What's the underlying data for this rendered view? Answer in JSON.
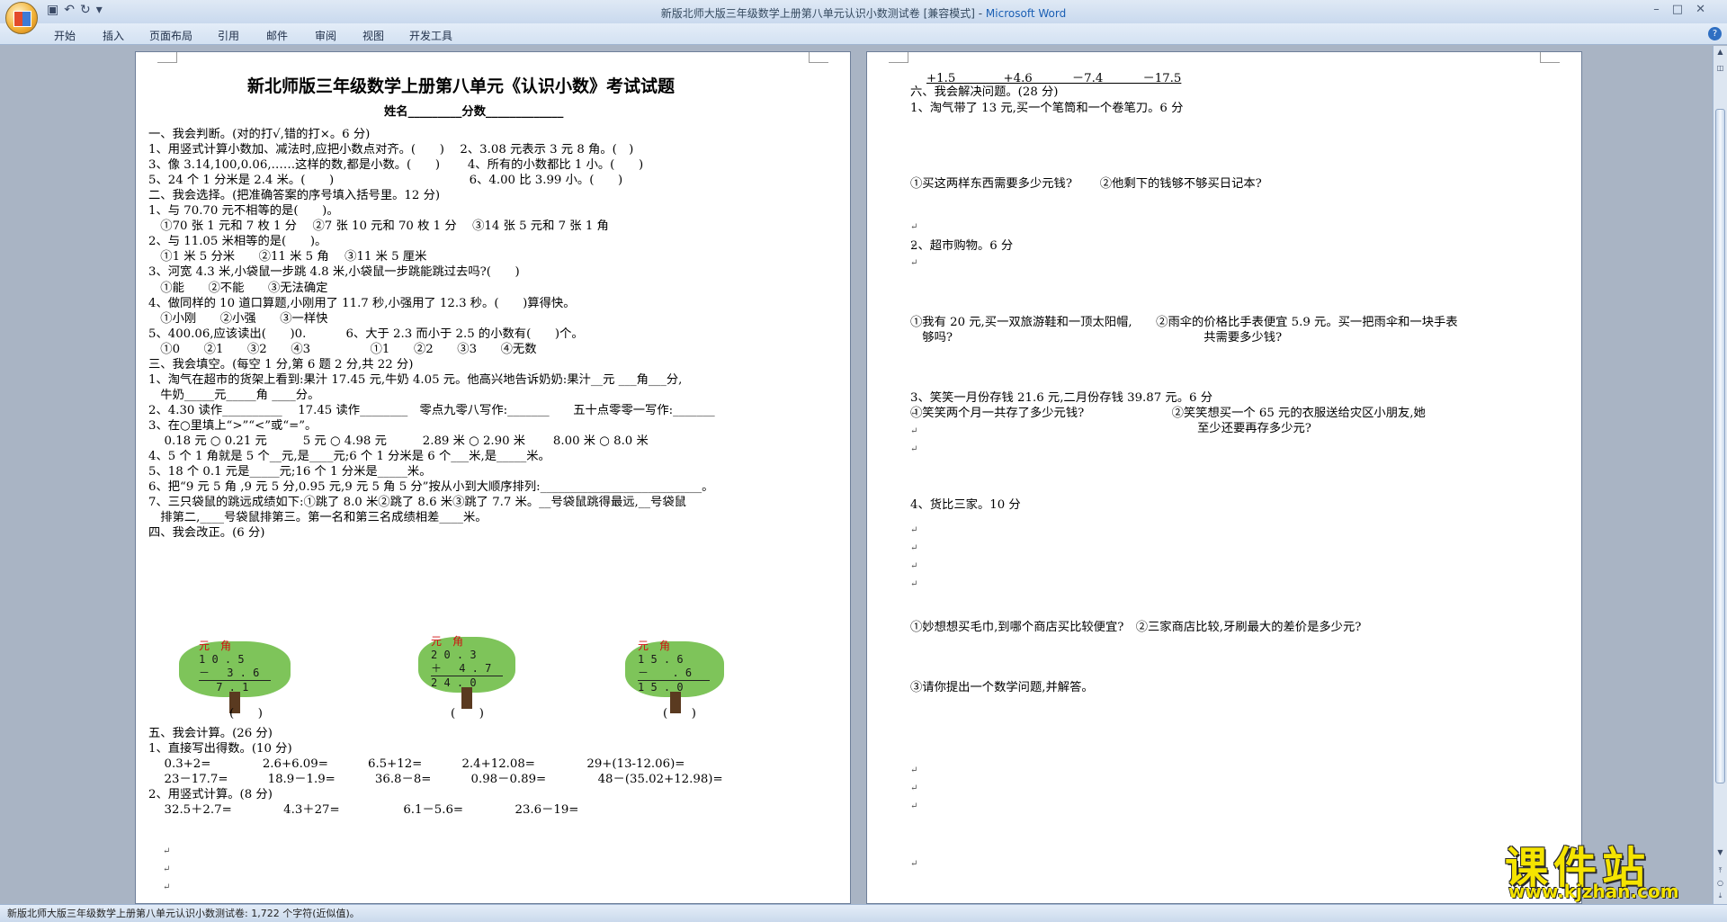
{
  "window": {
    "title_doc": "新版北师大版三年级数学上册第八单元认识小数测试卷 [兼容模式] - ",
    "title_app": "Microsoft Word"
  },
  "ribbon": {
    "tabs": [
      "开始",
      "插入",
      "页面布局",
      "引用",
      "邮件",
      "审阅",
      "视图",
      "开发工具"
    ]
  },
  "status": {
    "text": "新版北师大版三年级数学上册第八单元认识小数测试卷: 1,722 个字符(近似值)。"
  },
  "watermark": {
    "cn": "课件站",
    "url": "www.kjzhan.com"
  },
  "page1": {
    "title": "新北师版三年级数学上册第八单元《认识小数》考试试题",
    "name_line": "姓名_________分数_____________",
    "lines": [
      "一、我会判断。(对的打√,错的打×。6 分)",
      "1、用竖式计算小数加、减法时,应把小数点对齐。(　　)　 2、3.08 元表示 3 元 8 角。(　)",
      "3、像 3.14,100,0.06,……这样的数,都是小数。(　　)　　 4、所有的小数都比 1 小。(　　)",
      "5、24 个 1 分米是 2.4 米。(　　)　　　　　　　　　　　 6、4.00 比 3.99 小。(　　)",
      "二、我会选择。(把准确答案的序号填入括号里。12 分)",
      "1、与 70.70 元不相等的是(　　)。",
      "　①70 张 1 元和 7 枚 1 分　 ②7 张 10 元和 70 枚 1 分　 ③14 张 5 元和 7 张 1 角",
      "2、与 11.05 米相等的是(　　)。",
      "　①1 米 5 分米　　②11 米 5 角　 ③11 米 5 厘米",
      "3、河宽 4.3 米,小袋鼠一步跳 4.8 米,小袋鼠一步跳能跳过去吗?(　　)",
      "　①能　　②不能　　③无法确定",
      "4、做同样的 10 道口算题,小刚用了 11.7 秒,小强用了 12.3 秒。(　　)算得快。",
      "　①小刚　　②小强　　③一样快",
      "5、400.06,应该读出(　　)0.　　　 6、大于 2.3 而小于 2.5 的小数有(　　)个。",
      "　①0　　②1　　③2　　④3　　　　　①1　　②2　　③3　　④无数",
      "三、我会填空。(每空 1 分,第 6 题 2 分,共 22 分)",
      "1、淘气在超市的货架上看到:果汁 17.45 元,牛奶 4.05 元。他高兴地告诉奶奶:果汁__元 ___角___分,",
      "　牛奶_____元_____角 ____分。",
      "2、4.30 读作__________　 17.45 读作________　零点九零八写作:_______　　五十点零零一写作:_______",
      "3、在○里填上“>”“<”或“=”。",
      "　 0.18 元 ○ 0.21 元　　　5 元 ○ 4.98 元　　　2.89 米 ○ 2.90 米　　 8.00 米 ○ 8.0 米",
      "4、5 个 1 角就是 5 个__元,是____元;6 个 1 分米是 6 个___米,是_____米。",
      "5、18 个 0.1 元是_____元;16 个 1 分米是_____米。",
      "6、把“9 元 5 角 ,9 元 5 分,0.95 元,9 元 5 角 5 分”按从小到大顺序排列:___________________________。",
      "7、三只袋鼠的跳远成绩如下:①跳了 8.0 米②跳了 8.6 米③跳了 7.7 米。__号袋鼠跳得最远,__号袋鼠",
      "　排第二,____号袋鼠排第三。第一名和第三名成绩相差____米。",
      "四、我会改正。(6 分)"
    ],
    "trees": [
      {
        "head": "元　角",
        "rows": [
          "1 0 . 5",
          "－ 　3 . 6",
          "　 7 . 1"
        ],
        "paren": "(　　)"
      },
      {
        "head": "元　角",
        "rows": [
          "2 0 . 3",
          "＋ 　4 . 7",
          "2 4 . 0"
        ],
        "paren": "(　　)"
      },
      {
        "head": "元　角",
        "rows": [
          "1 5 . 6",
          "－ 　 . 6",
          "1 5 . 0"
        ],
        "paren": "(　　)"
      }
    ],
    "lines2": [
      "五、我会计算。(26 分)",
      "1、直接写出得数。(10 分)",
      "　 0.3+2=　　　　 2.6+6.09=　　　 6.5+12=　　　 2.4+12.08=　　　　 29+(13-12.06)=",
      "　 23－17.7=　　　 18.9－1.9=　　　 36.8－8=　　　 0.98－0.89=　　　　 48－(35.02+12.98)=",
      "2、用竖式计算。(8 分)",
      "　 32.5＋2.7=　　　　 4.3＋27=　　　　　 6.1－5.6=　　　　 23.6－19="
    ]
  },
  "page2": {
    "top_line": "+1.5　　　　+4.6　　　 －7.4　　　 －17.5",
    "lines": [
      "六、我会解决问题。(28 分)",
      "1、淘气带了 13 元,买一个笔筒和一个卷笔刀。6 分",
      "①买这两样东西需要多少元钱?　　 ②他剩下的钱够不够买日记本?",
      "2、超市购物。6 分",
      "①我有 20 元,买一双旅游鞋和一顶太阳帽,　　②雨伞的价格比手表便宜 5.9 元。买一把雨伞和一块手表",
      "　够吗?　　　　　　　　　　　　　　　　　　　　　共需要多少钱?",
      "3、笑笑一月份存钱 21.6 元,二月份存钱 39.87 元。6 分",
      "①笑笑两个月一共存了多少元钱?　　　　　　　 ②笑笑想买一个 65 元的衣服送给灾区小朋友,她",
      "　　　　　　　　　　　　　　　　　　　　　　　　至少还要再存多少元?",
      "4、货比三家。10 分",
      "①妙想想买毛巾,到哪个商店买比较便宜?　②三家商店比较,牙刷最大的差价是多少元?",
      "③请你提出一个数学问题,并解答。"
    ]
  }
}
